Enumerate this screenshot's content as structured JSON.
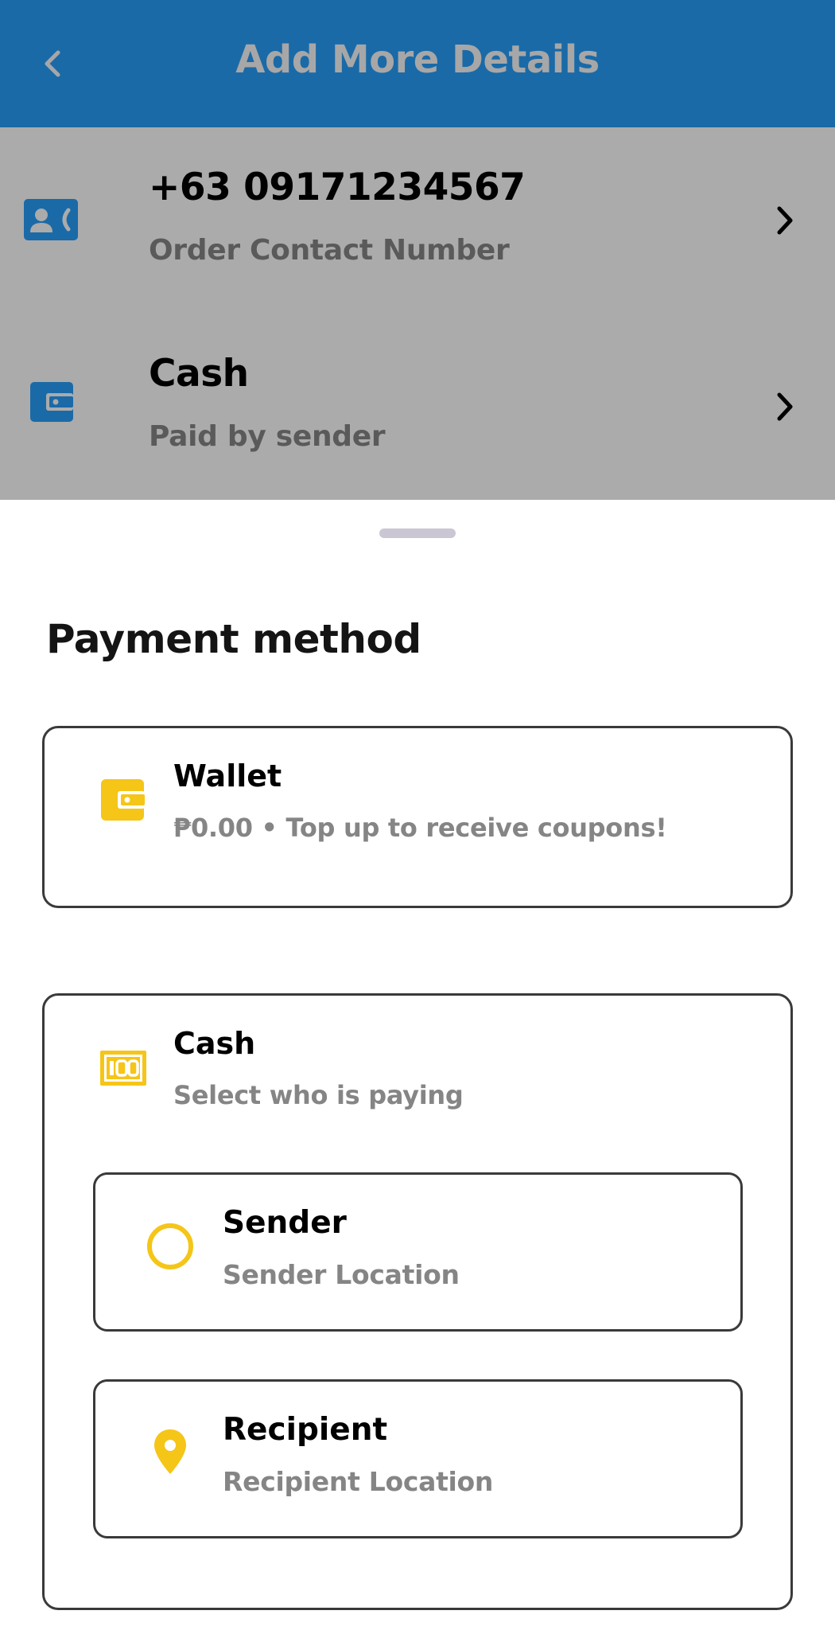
{
  "header": {
    "title": "Add More Details",
    "back_icon": "chevron-left-icon"
  },
  "details": {
    "contact": {
      "icon": "contact-phone-icon",
      "value": "+63 09171234567",
      "label": "Order Contact Number"
    },
    "payment": {
      "icon": "wallet-icon",
      "value": "Cash",
      "label": "Paid by sender"
    }
  },
  "sheet": {
    "title": "Payment method",
    "wallet": {
      "icon": "wallet-icon",
      "title": "Wallet",
      "subtitle": "₱0.00 • Top up to receive coupons!"
    },
    "cash": {
      "icon": "cash-bill-icon",
      "title": "Cash",
      "subtitle": "Select who is paying",
      "options": [
        {
          "icon": "radio-empty-icon",
          "title": "Sender",
          "subtitle": "Sender Location"
        },
        {
          "icon": "location-pin-icon",
          "title": "Recipient",
          "subtitle": "Recipient Location"
        }
      ]
    }
  },
  "colors": {
    "header_bg": "#1a6aa8",
    "dim_overlay": "#ababab",
    "accent_blue": "#1a6aa8",
    "accent_yellow": "#f5c518"
  }
}
